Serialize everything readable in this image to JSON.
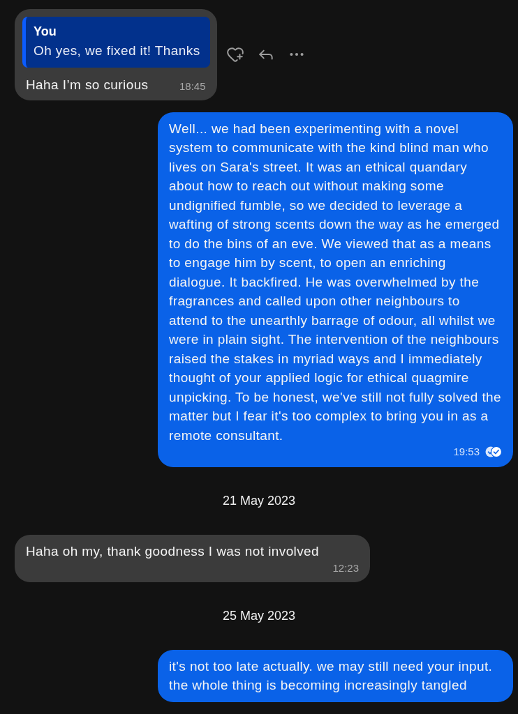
{
  "timeline": [
    {
      "kind": "incoming",
      "hovered": true,
      "quote": {
        "author": "You",
        "text": "Oh yes, we fixed it! Thanks"
      },
      "text": "Haha I’m so curious",
      "time": "18:45"
    },
    {
      "kind": "outgoing",
      "text": "Well... we had been experimenting with a novel system to communicate with the kind blind man who lives on Sara's street. It was an ethical quandary about how to reach out without making some undignified fumble, so we decided to leverage a wafting of strong scents down the way as he emerged to do the bins of an eve. We viewed that as a means to engage him by scent, to open an enriching dialogue. It backfired. He was overwhelmed by the fragrances and called upon other neighbours to attend to the unearthly barrage of odour, all whilst we were in plain sight. The intervention of the neighbours raised the stakes in myriad ways and I immediately thought of your applied logic for ethical quagmire unpicking. To be honest, we've still not fully solved the matter but I fear it's too complex to bring you in as a remote consultant.",
      "time": "19:53",
      "read": true
    },
    {
      "kind": "date",
      "text": "21 May 2023"
    },
    {
      "kind": "incoming",
      "hovered": false,
      "text": "Haha oh my, thank goodness I was not involved",
      "time": "12:23"
    },
    {
      "kind": "date",
      "text": "25 May 2023"
    },
    {
      "kind": "outgoing",
      "text": "it's not too late actually. we may still need your input. the whole thing is becoming increasingly tangled"
    }
  ]
}
